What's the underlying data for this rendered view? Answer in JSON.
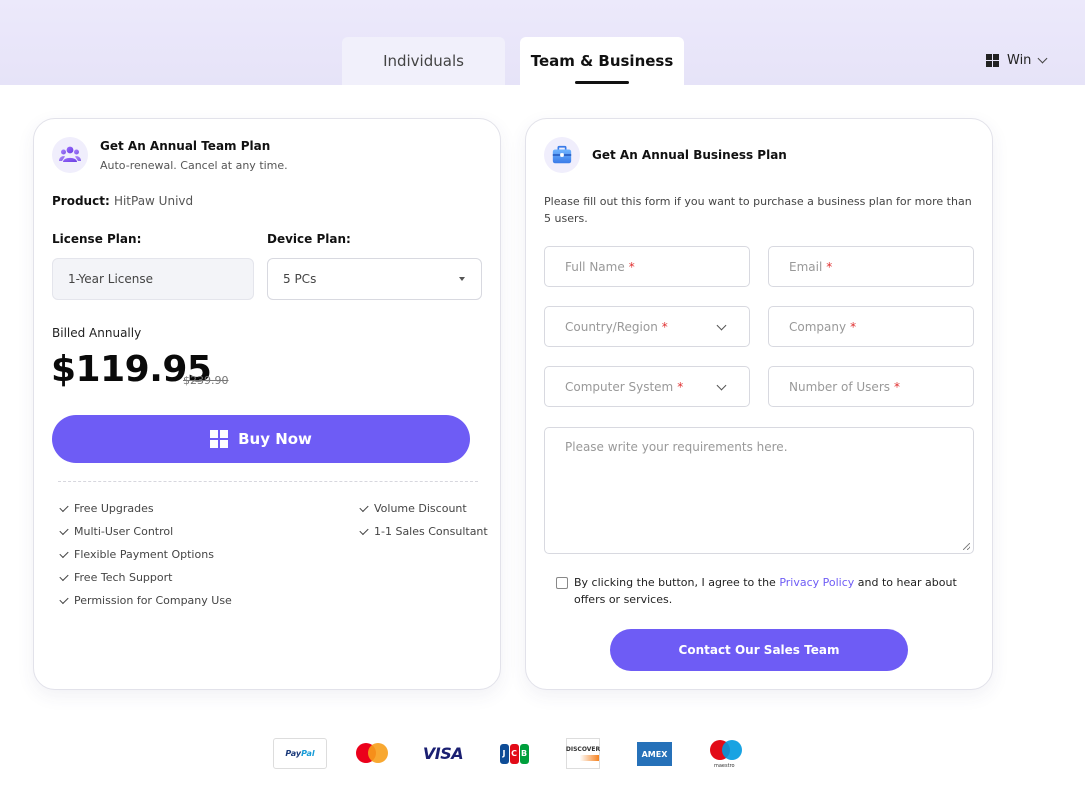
{
  "tabs": [
    {
      "label": "Individuals",
      "active": false
    },
    {
      "label": "Team & Business",
      "active": true
    }
  ],
  "os_select": {
    "label": "Win",
    "icon": "windows-icon"
  },
  "team_plan": {
    "title": "Get An Annual Team Plan",
    "subtitle": "Auto-renewal. Cancel at any time.",
    "icon": "team-icon",
    "product_label": "Product:",
    "product_value": "HitPaw Univd",
    "license_label": "License Plan:",
    "license_value": "1-Year License",
    "device_label": "Device Plan:",
    "device_value": "5 PCs",
    "billed": "Billed Annually",
    "price": "$119.95",
    "price_original": "$239.90",
    "buy_button": "Buy Now",
    "features_left": [
      "Free Upgrades",
      "Multi-User Control",
      "Flexible Payment Options",
      "Free Tech Support",
      "Permission for Company Use"
    ],
    "features_right": [
      "Volume Discount",
      "1-1 Sales Consultant"
    ]
  },
  "business_plan": {
    "title": "Get An Annual Business Plan",
    "icon": "briefcase-icon",
    "description": "Please fill out this form if you want to purchase a business plan for more than 5 users.",
    "fields": {
      "full_name": "Full Name",
      "email": "Email",
      "country": "Country/Region",
      "company": "Company",
      "computer_system": "Computer System",
      "number_of_users": "Number of Users",
      "requirements": "Please write your requirements here."
    },
    "required_mark": "*",
    "consent_prefix": "By clicking the button, I agree to the ",
    "consent_link": "Privacy Policy",
    "consent_suffix": " and to hear about offers or services.",
    "contact_button": "Contact Our Sales Team"
  },
  "payment_methods": [
    "PayPal",
    "Mastercard",
    "VISA",
    "JCB",
    "DISCOVER",
    "AMEX",
    "maestro"
  ],
  "colors": {
    "accent": "#6e5cf5",
    "band": "#ece9fb",
    "required": "#e03030"
  }
}
